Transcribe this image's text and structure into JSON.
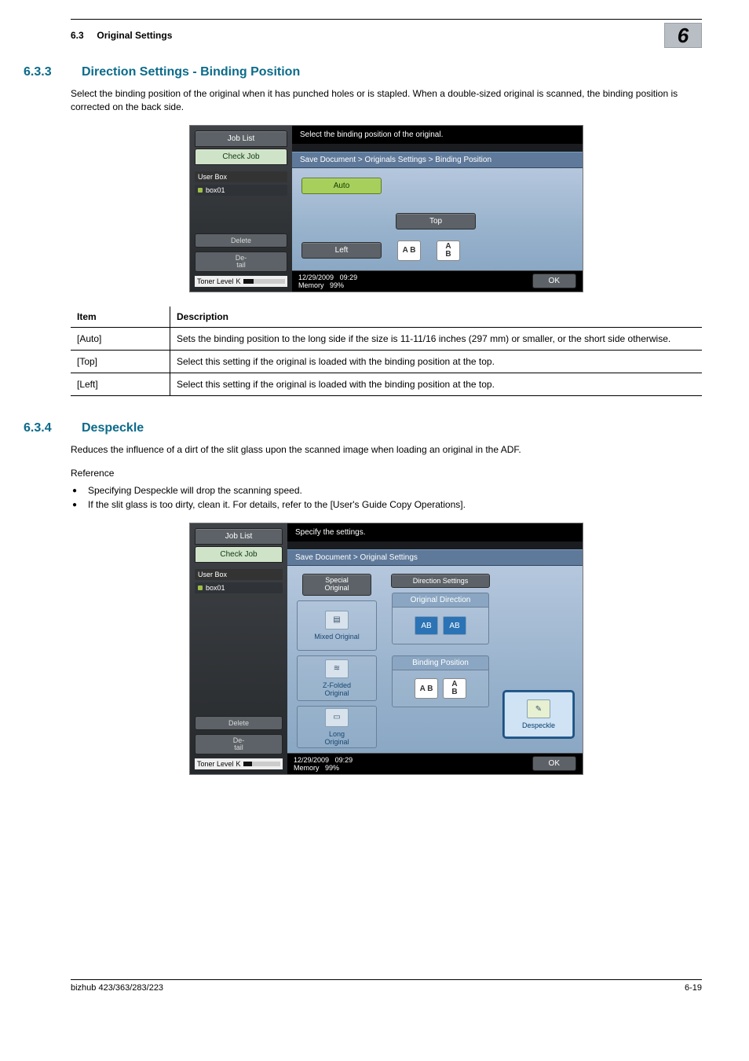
{
  "header": {
    "section_ref": "6.3",
    "section_title": "Original Settings",
    "chapter_number": "6"
  },
  "s633": {
    "number": "6.3.3",
    "title": "Direction Settings - Binding Position",
    "intro": "Select the binding position of the original when it has punched holes or is stapled. When a double-sized original is scanned, the binding position is corrected on the back side."
  },
  "shot1": {
    "tabs": {
      "job_list": "Job List",
      "check_job": "Check Job"
    },
    "left": {
      "label": "User Box",
      "item": "box01",
      "delete_btn": "Delete",
      "detail_btn": "De-\ntail",
      "toner": "Toner Level",
      "toner_k": "K"
    },
    "prompt": "Select the binding position of the original.",
    "breadcrumb": "Save Document > Originals Settings > Binding Position",
    "opts": {
      "auto": "Auto",
      "top": "Top",
      "left": "Left"
    },
    "foot": {
      "date": "12/29/2009",
      "time": "09:29",
      "mem_label": "Memory",
      "mem_val": "99%",
      "ok": "OK"
    }
  },
  "table": {
    "col_item": "Item",
    "col_desc": "Description",
    "rows": [
      {
        "item": "[Auto]",
        "desc": "Sets the binding position to the long side if the size is 11-11/16 inches (297 mm) or smaller, or the short side otherwise."
      },
      {
        "item": "[Top]",
        "desc": "Select this setting if the original is loaded with the binding position at the top."
      },
      {
        "item": "[Left]",
        "desc": "Select this setting if the original is loaded with the binding position at the top."
      }
    ]
  },
  "s634": {
    "number": "6.3.4",
    "title": "Despeckle",
    "intro": "Reduces the influence of a dirt of the slit glass upon the scanned image when loading an original in the ADF.",
    "reference_label": "Reference",
    "bullets": [
      "Specifying Despeckle will drop the scanning speed.",
      "If the slit glass is too dirty, clean it. For details, refer to the [User's Guide Copy Operations]."
    ]
  },
  "shot2": {
    "prompt": "Specify the settings.",
    "breadcrumb": "Save Document > Original Settings",
    "col1": {
      "header": "Special\nOriginal",
      "mixed": "Mixed Original",
      "zfold": "Z-Folded\nOriginal",
      "long": "Long\nOriginal"
    },
    "col2": {
      "header": "Direction Settings",
      "orig_dir": "Original Direction",
      "bind_pos": "Binding Position"
    },
    "despeckle": "Despeckle"
  },
  "footer": {
    "product": "bizhub 423/363/283/223",
    "page": "6-19"
  }
}
